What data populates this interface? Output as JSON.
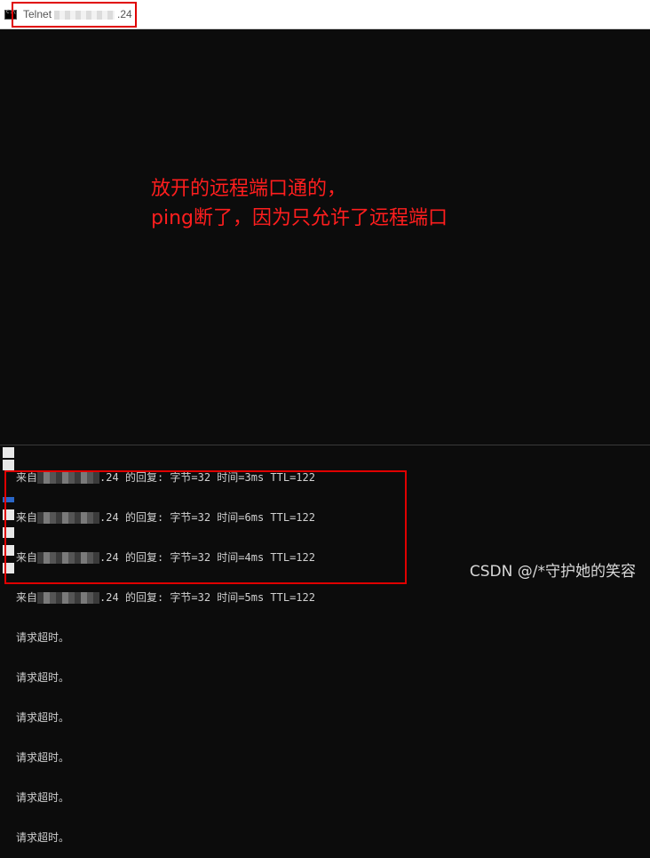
{
  "window": {
    "title_prefix": "Telnet",
    "title_suffix": ".24"
  },
  "annotation": {
    "line1": "放开的远程端口通的，",
    "line2": "ping断了，因为只允许了远程端口"
  },
  "console": {
    "reply_lines": [
      {
        "prefix": "来自",
        "ip_suffix": ".24",
        "text": "的回复: 字节=32 时间=3ms TTL=122"
      },
      {
        "prefix": "来自",
        "ip_suffix": ".24",
        "text": "的回复: 字节=32 时间=6ms TTL=122"
      },
      {
        "prefix": "来自",
        "ip_suffix": ".24",
        "text": "的回复: 字节=32 时间=4ms TTL=122"
      },
      {
        "prefix": "来自",
        "ip_suffix": ".24",
        "text": "的回复: 字节=32 时间=5ms TTL=122"
      }
    ],
    "timeout_lines": [
      "请求超时。",
      "请求超时。",
      "请求超时。",
      "请求超时。",
      "请求超时。",
      "请求超时。"
    ]
  },
  "watermark": "CSDN @/*守护她的笑容",
  "colors": {
    "console_bg": "#0c0c0c",
    "annotation": "#ff1e1e",
    "highlight_box": "#e00000"
  }
}
